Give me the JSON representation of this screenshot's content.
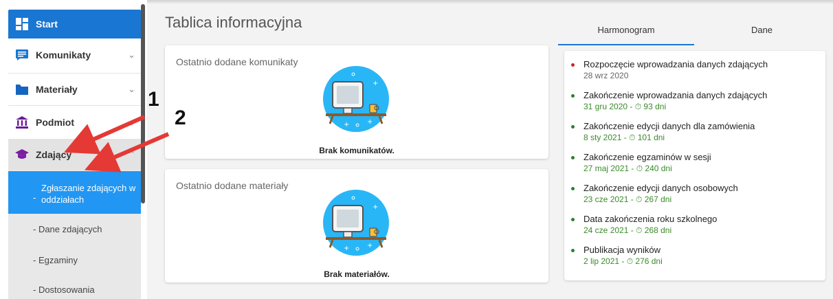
{
  "sidebar": {
    "start_label": "Start",
    "komunikaty_label": "Komunikaty",
    "materialy_label": "Materiały",
    "podmiot_label": "Podmiot",
    "zdajacy_label": "Zdający",
    "sub_dash": "-",
    "sub_active": "Zgłaszanie zdających w oddziałach",
    "sub_items": [
      "- Dane zdających",
      "- Egzaminy",
      "- Dostosowania"
    ]
  },
  "main": {
    "title": "Tablica informacyjna",
    "cards": [
      {
        "title": "Ostatnio dodane komunikaty",
        "empty": "Brak komunikatów."
      },
      {
        "title": "Ostatnio dodane materiały",
        "empty": "Brak materiałów."
      }
    ]
  },
  "tabs": [
    "Harmonogram",
    "Dane"
  ],
  "timeline": [
    {
      "title": "Rozpoczęcie wprowadzania danych zdających",
      "date": "28 wrz 2020",
      "dot_color": "#c62828"
    },
    {
      "title": "Zakończenie wprowadzania danych zdających",
      "date": "31 gru 2020 - ⏱ 93 dni",
      "dot_color": "#2e7d32"
    },
    {
      "title": "Zakończenie edycji danych dla zamówienia",
      "date": "8 sty 2021 - ⏱ 101 dni",
      "dot_color": "#2e7d32"
    },
    {
      "title": "Zakończenie egzaminów w sesji",
      "date": "27 maj 2021 - ⏱ 240 dni",
      "dot_color": "#2e7d32"
    },
    {
      "title": "Zakończenie edycji danych osobowych",
      "date": "23 cze 2021 - ⏱ 267 dni",
      "dot_color": "#2e7d32"
    },
    {
      "title": "Data zakończenia roku szkolnego",
      "date": "24 cze 2021 - ⏱ 268 dni",
      "dot_color": "#2e7d32"
    },
    {
      "title": "Publikacja wyników",
      "date": "2 lip 2021 - ⏱ 276 dni",
      "dot_color": "#2e7d32"
    }
  ],
  "annotations": {
    "first": "1",
    "second": "2",
    "arrow_color": "#e53935"
  },
  "colors": {
    "primary": "#1976d2",
    "active_sub": "#2196f3",
    "accent_green": "#3a8a2a"
  }
}
